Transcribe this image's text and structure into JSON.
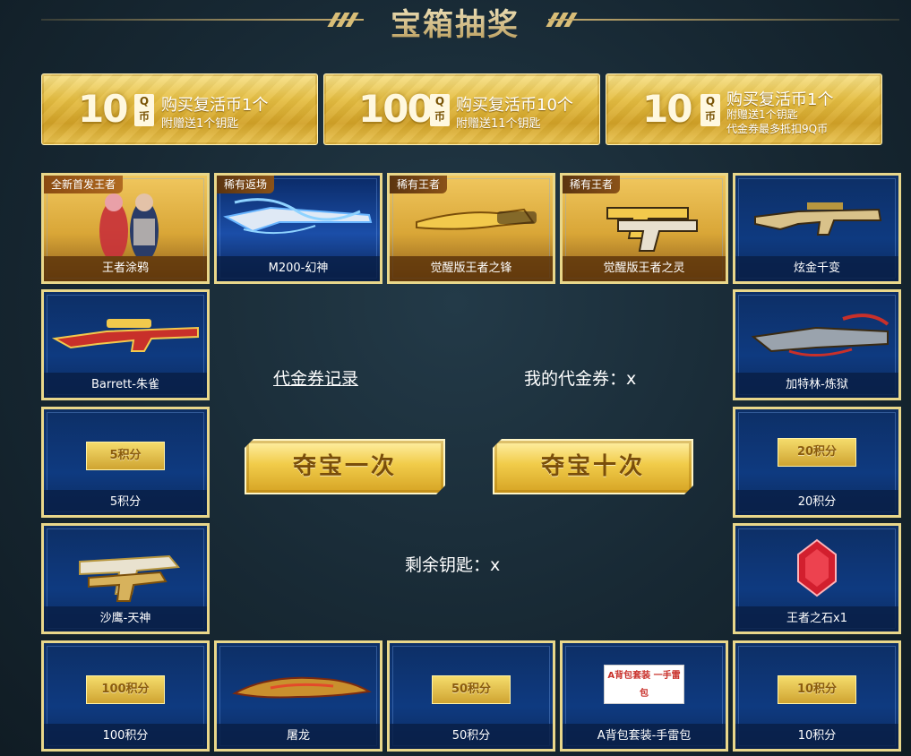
{
  "header": {
    "title": "宝箱抽奖"
  },
  "offers": [
    {
      "amount": "10",
      "currency": "Q币",
      "main": "购买复活币1个",
      "sub1": "附赠送1个钥匙",
      "sub2": ""
    },
    {
      "amount": "100",
      "currency": "Q币",
      "main": "购买复活币10个",
      "sub1": "附赠送11个钥匙",
      "sub2": ""
    },
    {
      "amount": "10",
      "currency": "Q币",
      "main": "购买复活币1个",
      "sub1": "附赠送1个钥匙",
      "sub2": "代金券最多抵扣9Q币"
    }
  ],
  "prizes": {
    "p1": {
      "tag": "全新首发王者",
      "label": "王者涂鸦"
    },
    "p2": {
      "tag": "稀有返场",
      "label": "M200-幻神"
    },
    "p3": {
      "tag": "稀有王者",
      "label": "觉醒版王者之锋"
    },
    "p4": {
      "tag": "稀有王者",
      "label": "觉醒版王者之灵"
    },
    "p5": {
      "label": "炫金千变"
    },
    "p6": {
      "label": "Barrett-朱雀"
    },
    "p7": {
      "label": "加特林-炼狱"
    },
    "p8": {
      "badge": "5积分",
      "label": "5积分"
    },
    "p9": {
      "badge": "20积分",
      "label": "20积分"
    },
    "p10": {
      "label": "沙鹰-天神"
    },
    "p11": {
      "label": "王者之石x1"
    },
    "p12": {
      "badge": "100积分",
      "label": "100积分"
    },
    "p13": {
      "label": "屠龙"
    },
    "p14": {
      "badge": "50积分",
      "label": "50积分"
    },
    "p15": {
      "badge": "A背包套装 一手雷包",
      "label": "A背包套装-手雷包"
    },
    "p16": {
      "badge": "10积分",
      "label": "10积分"
    }
  },
  "center": {
    "voucher_link": "代金券记录",
    "my_voucher": "我的代金券：x",
    "draw_once": "夺宝一次",
    "draw_ten": "夺宝十次",
    "keys_left": "剩余钥匙：x"
  },
  "colors": {
    "gold": "#e9c452",
    "tile_blue": "#0e3a80",
    "frame": "#e9d78a",
    "background": "#172833"
  }
}
